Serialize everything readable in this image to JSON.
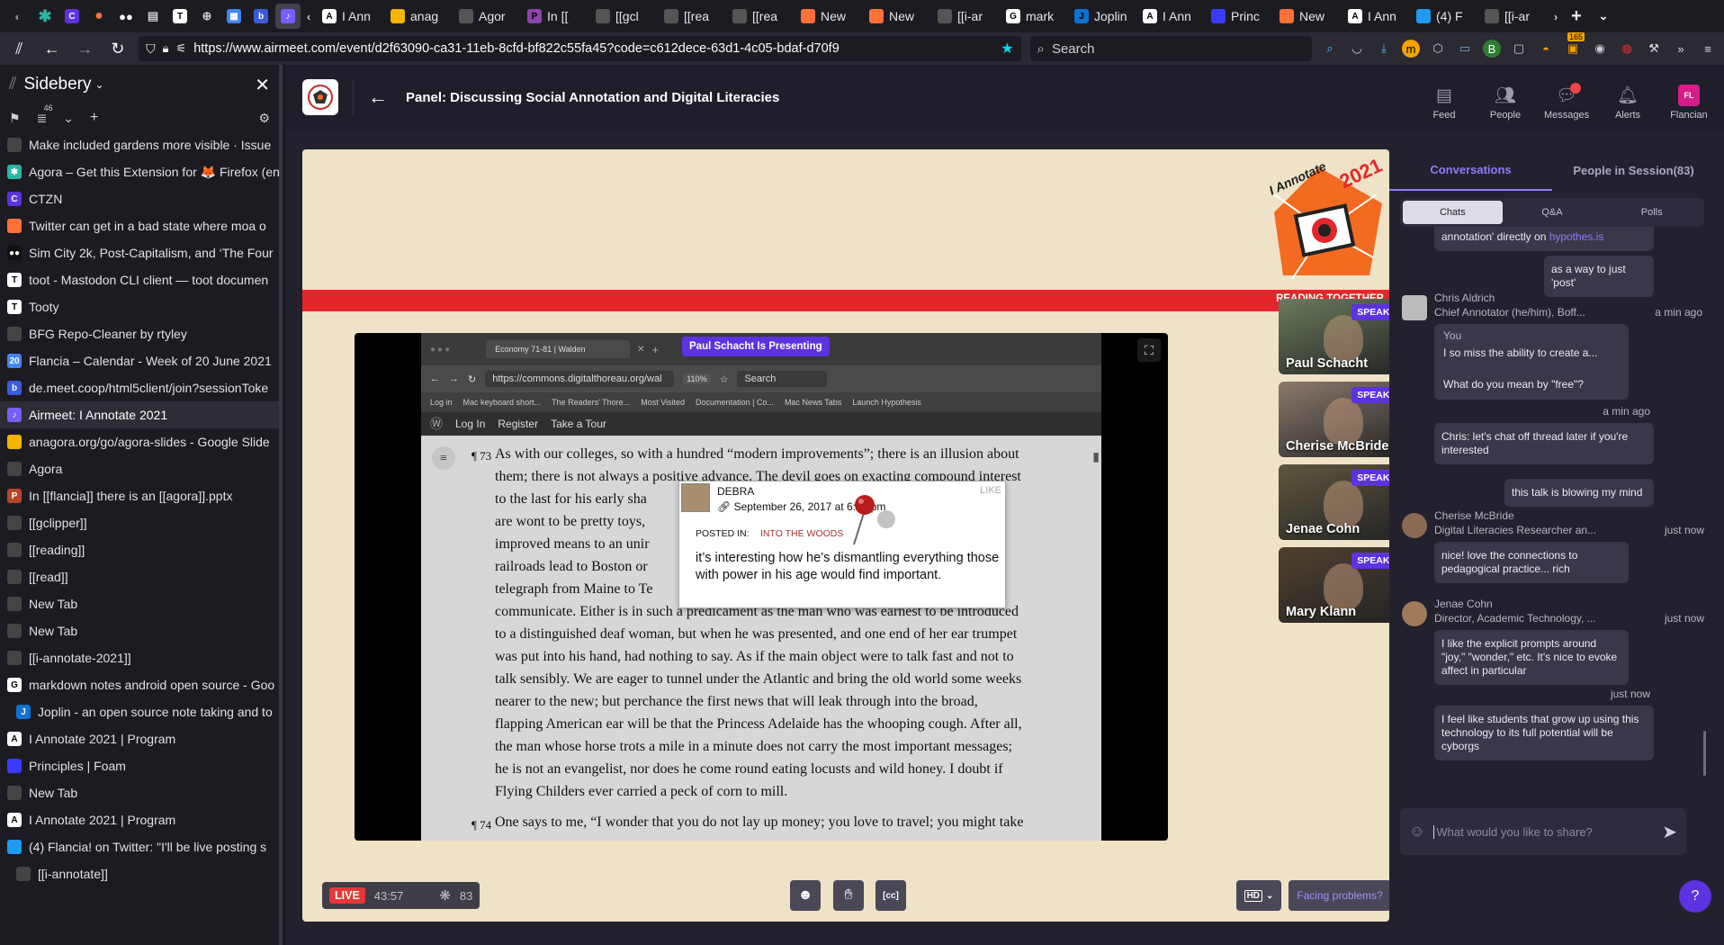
{
  "tabstrip": {
    "tabs": [
      {
        "label": "I Ann",
        "fav_color": "#ffffff",
        "fav_text": "A"
      },
      {
        "label": "anag",
        "fav_color": "#f4b400",
        "fav_text": ""
      },
      {
        "label": "Agor",
        "fav_color": "#555555",
        "fav_text": ""
      },
      {
        "label": "In [[",
        "fav_color": "#8e44ad",
        "fav_text": "P"
      },
      {
        "label": "[[gcl",
        "fav_color": "#555555",
        "fav_text": ""
      },
      {
        "label": "[[rea",
        "fav_color": "#555555",
        "fav_text": ""
      },
      {
        "label": "[[rea",
        "fav_color": "#555555",
        "fav_text": ""
      },
      {
        "label": "New",
        "fav_color": "#ff7139",
        "fav_text": ""
      },
      {
        "label": "New",
        "fav_color": "#ff7139",
        "fav_text": ""
      },
      {
        "label": "[[i-ar",
        "fav_color": "#555555",
        "fav_text": ""
      },
      {
        "label": "mark",
        "fav_color": "#ffffff",
        "fav_text": "G"
      },
      {
        "label": "Joplin",
        "fav_color": "#1071d3",
        "fav_text": "J"
      },
      {
        "label": "I Ann",
        "fav_color": "#ffffff",
        "fav_text": "A"
      },
      {
        "label": "Princ",
        "fav_color": "#3b3bff",
        "fav_text": ""
      },
      {
        "label": "New",
        "fav_color": "#ff7139",
        "fav_text": ""
      },
      {
        "label": "I Ann",
        "fav_color": "#ffffff",
        "fav_text": "A"
      },
      {
        "label": "(4) F",
        "fav_color": "#1d9bf0",
        "fav_text": ""
      },
      {
        "label": "[[i-ar",
        "fav_color": "#555555",
        "fav_text": ""
      }
    ]
  },
  "navbar": {
    "url": "https://www.airmeet.com/event/d2f63090-ca31-11eb-8cfd-bf822c55fa45?code=c612dece-63d1-4c05-bdaf-d70f9",
    "search_placeholder": "Search",
    "ext_badge": "165"
  },
  "sidebar": {
    "title": "Sidebery",
    "tab_count": "46",
    "items": [
      {
        "label": "Make included gardens more visible · Issue",
        "fav_color": "#444444",
        "fav_text": "",
        "indent": 0
      },
      {
        "label": "Agora – Get this Extension for 🦊 Firefox (en",
        "fav_color": "#2bb5a3",
        "fav_text": "✱",
        "indent": 0
      },
      {
        "label": "CTZN",
        "fav_color": "#5b33e0",
        "fav_text": "C",
        "indent": 0
      },
      {
        "label": "Twitter can get in a bad state where moa o",
        "fav_color": "#ff7139",
        "fav_text": "",
        "indent": 0
      },
      {
        "label": "Sim City 2k, Post-Capitalism, and ‘The Four",
        "fav_color": "#111111",
        "fav_text": "●●",
        "indent": 0
      },
      {
        "label": "toot - Mastodon CLI client — toot documen",
        "fav_color": "#ffffff",
        "fav_text": "T",
        "indent": 0
      },
      {
        "label": "Tooty",
        "fav_color": "#ffffff",
        "fav_text": "T",
        "indent": 0
      },
      {
        "label": "BFG Repo-Cleaner by rtyley",
        "fav_color": "#444444",
        "fav_text": "",
        "indent": 0
      },
      {
        "label": "Flancia – Calendar - Week of 20 June 2021",
        "fav_color": "#4285f4",
        "fav_text": "20",
        "indent": 0
      },
      {
        "label": "de.meet.coop/html5client/join?sessionToke",
        "fav_color": "#3b5bdb",
        "fav_text": "b",
        "indent": 0
      },
      {
        "label": "Airmeet: I Annotate 2021",
        "fav_color": "#7b5cff",
        "fav_text": "♪",
        "indent": 0,
        "active": true
      },
      {
        "label": "anagora.org/go/agora-slides - Google Slide",
        "fav_color": "#f4b400",
        "fav_text": "",
        "indent": 0
      },
      {
        "label": "Agora",
        "fav_color": "#444444",
        "fav_text": "",
        "indent": 0
      },
      {
        "label": "In [[flancia]] there is an [[agora]].pptx",
        "fav_color": "#b7472a",
        "fav_text": "P",
        "indent": 0
      },
      {
        "label": "[[gclipper]]",
        "fav_color": "#444444",
        "fav_text": "",
        "indent": 0
      },
      {
        "label": "[[reading]]",
        "fav_color": "#444444",
        "fav_text": "",
        "indent": 0
      },
      {
        "label": "[[read]]",
        "fav_color": "#444444",
        "fav_text": "",
        "indent": 0
      },
      {
        "label": "New Tab",
        "fav_color": "#444444",
        "fav_text": "",
        "indent": 0
      },
      {
        "label": "New Tab",
        "fav_color": "#444444",
        "fav_text": "",
        "indent": 0
      },
      {
        "label": "[[i-annotate-2021]]",
        "fav_color": "#444444",
        "fav_text": "",
        "indent": 0
      },
      {
        "label": "markdown notes android open source - Goo",
        "fav_color": "#ffffff",
        "fav_text": "G",
        "indent": 0
      },
      {
        "label": "Joplin - an open source note taking and to",
        "fav_color": "#1071d3",
        "fav_text": "J",
        "indent": 1
      },
      {
        "label": "I Annotate 2021 | Program",
        "fav_color": "#ffffff",
        "fav_text": "A",
        "indent": 0
      },
      {
        "label": "Principles | Foam",
        "fav_color": "#3b3bff",
        "fav_text": "",
        "indent": 0
      },
      {
        "label": "New Tab",
        "fav_color": "#444444",
        "fav_text": "",
        "indent": 0
      },
      {
        "label": "I Annotate 2021 | Program",
        "fav_color": "#ffffff",
        "fav_text": "A",
        "indent": 0
      },
      {
        "label": "(4) Flancia! on Twitter: \"I'll be live posting s",
        "fav_color": "#1d9bf0",
        "fav_text": "",
        "indent": 0
      },
      {
        "label": "[[i-annotate]]",
        "fav_color": "#444444",
        "fav_text": "",
        "indent": 1
      }
    ]
  },
  "app": {
    "session_title": "Panel: Discussing Social Annotation and Digital Literacies",
    "nav": [
      {
        "label": "Feed",
        "icon": "feed-icon"
      },
      {
        "label": "People",
        "icon": "people-icon"
      },
      {
        "label": "Messages",
        "icon": "messages-icon"
      },
      {
        "label": "Alerts",
        "icon": "alerts-icon"
      },
      {
        "label": "Flancian",
        "icon": "avatar",
        "initials": "FL"
      }
    ]
  },
  "stage": {
    "brand_top": "I Annotate",
    "brand_year": "2021",
    "brand_tagline": "READING TOGETHER",
    "presenting_label": "Paul Schacht Is Presenting",
    "shared": {
      "tab_title": "Economy 71-81 | Walden",
      "url": "https://commons.digitalthoreau.org/wal",
      "zoom": "110%",
      "search": "Search",
      "bookmarks": [
        "Log in",
        "Mac keyboard short...",
        "The Readers' Thore...",
        "Most Visited",
        "Documentation | Co...",
        "Mac News Tabs",
        "Launch Hypothesis"
      ],
      "hyp_links": [
        "Log In",
        "Register",
        "Take a Tour"
      ],
      "para73_num": "¶ 73",
      "para73_lines": [
        "As with our colleges, so with a hundred “modern improvements”; there is an illusion about",
        "them; there is not always a positive advance. The devil goes on exacting compound interest",
        "to the last for his early sha",
        "are wont to be pretty toys,",
        "improved means to an unir",
        "railroads lead to Boston or",
        "telegraph from Maine to Te",
        "communicate. Either is in such a predicament as the man who was earnest to be introduced",
        "to a distinguished deaf woman, but when he was presented, and one end of her ear trumpet",
        "was put into his hand, had nothing to say. As if the main object were to talk fast and not to",
        "talk sensibly. We are eager to tunnel under the Atlantic and bring the old world some weeks",
        "nearer to the new; but perchance the first news that will leak through into the broad,",
        "flapping American ear will be that the Princess Adelaide has the whooping cough. After all,",
        "the man whose horse trots a mile in a minute does not carry the most important messages;",
        "he is not an evangelist, nor does he come round eating locusts and wild honey. I doubt if",
        "Flying Childers ever carried a peck of corn to mill."
      ],
      "para74_num": "¶ 74",
      "para74_line": "One says to me, “I wonder that you do not lay up money; you love to travel; you might take",
      "annotation": {
        "author": "DEBRA",
        "like": "LIKE",
        "date": "September 26, 2017 at 6:38 pm",
        "posted_in_label": "POSTED IN:",
        "posted_in_value": "INTO THE WOODS",
        "text": "it’s interesting how he’s dismantling everything those with power in his age would find important."
      }
    },
    "speakers": [
      {
        "name": "Paul Schacht",
        "badge": "SPEAKER",
        "mic": "on",
        "bg": "#6b7a5e"
      },
      {
        "name": "Cherise McBride",
        "badge": "SPEAKER",
        "mic": "muted",
        "bg": "#8a7a6e"
      },
      {
        "name": "Jenae Cohn",
        "badge": "SPEAKER",
        "mic": "muted",
        "bg": "#5e5640"
      },
      {
        "name": "Mary Klann",
        "badge": "SPEAKER",
        "mic": "muted",
        "bg": "#4e4030"
      }
    ],
    "bottom": {
      "live": "LIVE",
      "timer": "43:57",
      "attendees": "83",
      "quality": "HD",
      "facing_problems": "Facing problems?"
    }
  },
  "chat": {
    "tabs": [
      "Conversations",
      "People in Session(83)"
    ],
    "segments": [
      "Chats",
      "Q&A",
      "Polls"
    ],
    "top_fragment_prefix": "annotation' directly on ",
    "top_fragment_link": "hypothes.is",
    "msg_post": "as a way to just 'post'",
    "chris": {
      "name": "Chris Aldrich",
      "role": "Chief Annotator (he/him), Boff...",
      "time": "a min ago",
      "quote_author": "You",
      "quote_text": "I so miss the ability to create a...",
      "reply": "What do you mean by \"free\"?"
    },
    "own_time_1": "a min ago",
    "own_msg_1": "Chris: let's chat off thread later if you're interested",
    "own_msg_2": "this talk is blowing my mind",
    "cherise": {
      "name": "Cherise McBride",
      "role": "Digital Literacies Researcher an...",
      "time": "just now",
      "msg": "nice! love the connections to pedagogical practice... rich"
    },
    "jenae": {
      "name": "Jenae Cohn",
      "role": "Director, Academic Technology, ...",
      "time": "just now",
      "msg": "I like the explicit prompts around \"joy,\" \"wonder,\" etc. It's nice to evoke affect in particular"
    },
    "own_time_2": "just now",
    "own_msg_3": "I feel like students that grow up using this technology to its full potential will be cyborgs",
    "compose_placeholder": "What would you like to share?"
  }
}
